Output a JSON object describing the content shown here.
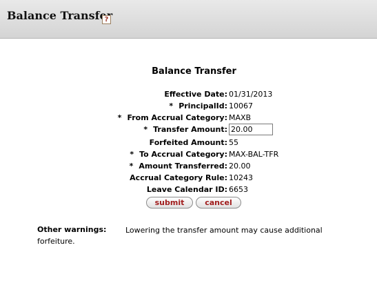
{
  "header": {
    "title": "Balance Transfer",
    "help_icon": "?"
  },
  "form": {
    "title": "Balance Transfer",
    "fields": {
      "effective_date": {
        "label": "Effective Date:",
        "value": "01/31/2013"
      },
      "principal_id": {
        "required": "*",
        "label": "PrincipalId:",
        "value": "10067"
      },
      "from_accrual_category": {
        "required": "*",
        "label": "From Accrual Category:",
        "value": "MAXB"
      },
      "transfer_amount": {
        "required": "*",
        "label": "Transfer Amount:",
        "value": "20.00"
      },
      "forfeited_amount": {
        "label": "Forfeited Amount:",
        "value": "55"
      },
      "to_accrual_category": {
        "required": "*",
        "label": "To Accrual Category:",
        "value": "MAX-BAL-TFR"
      },
      "amount_transferred": {
        "required": "*",
        "label": "Amount Transferred:",
        "value": "20.00"
      },
      "accrual_category_rule": {
        "label": "Accrual Category Rule:",
        "value": "10243"
      },
      "leave_calendar_id": {
        "label": "Leave Calendar ID:",
        "value": "6653"
      }
    },
    "buttons": {
      "submit": "submit",
      "cancel": "cancel"
    }
  },
  "warnings": {
    "label": "Other warnings:",
    "text": "Lowering the transfer amount may cause additional forfeiture."
  },
  "colors": {
    "button_text": "#a01c1c",
    "header_bg": "#dedede"
  }
}
